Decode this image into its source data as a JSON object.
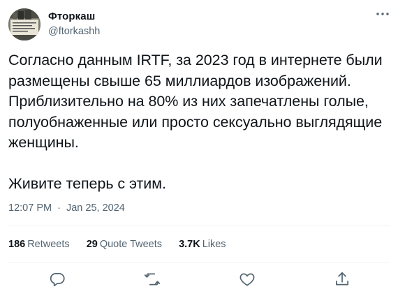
{
  "author": {
    "name": "Фторкаш",
    "handle": "@ftorkashh",
    "avatar_icon": "avatar-image"
  },
  "tweet": {
    "lines": [
      "Согласно данным IRTF, за 2023 год в интернете были",
      "размещены свыше 65 миллиардов изображений.",
      "Приблизительно на 80% из них запечатлены голые,",
      "полуобнаженные или просто сексуально выглядящие",
      "женщины."
    ],
    "closing": "Живите теперь с этим.",
    "time": "12:07 PM",
    "separator": "·",
    "date": "Jan 25, 2024"
  },
  "stats": {
    "retweets_count": "186",
    "retweets_label": "Retweets",
    "quotes_count": "29",
    "quotes_label": "Quote Tweets",
    "likes_count": "3.7K",
    "likes_label": "Likes"
  },
  "actions": [
    "reply-icon",
    "retweet-icon",
    "like-icon",
    "share-icon"
  ],
  "colors": {
    "text": "#0f1419",
    "secondary": "#536471",
    "divider": "#eff3f4"
  }
}
